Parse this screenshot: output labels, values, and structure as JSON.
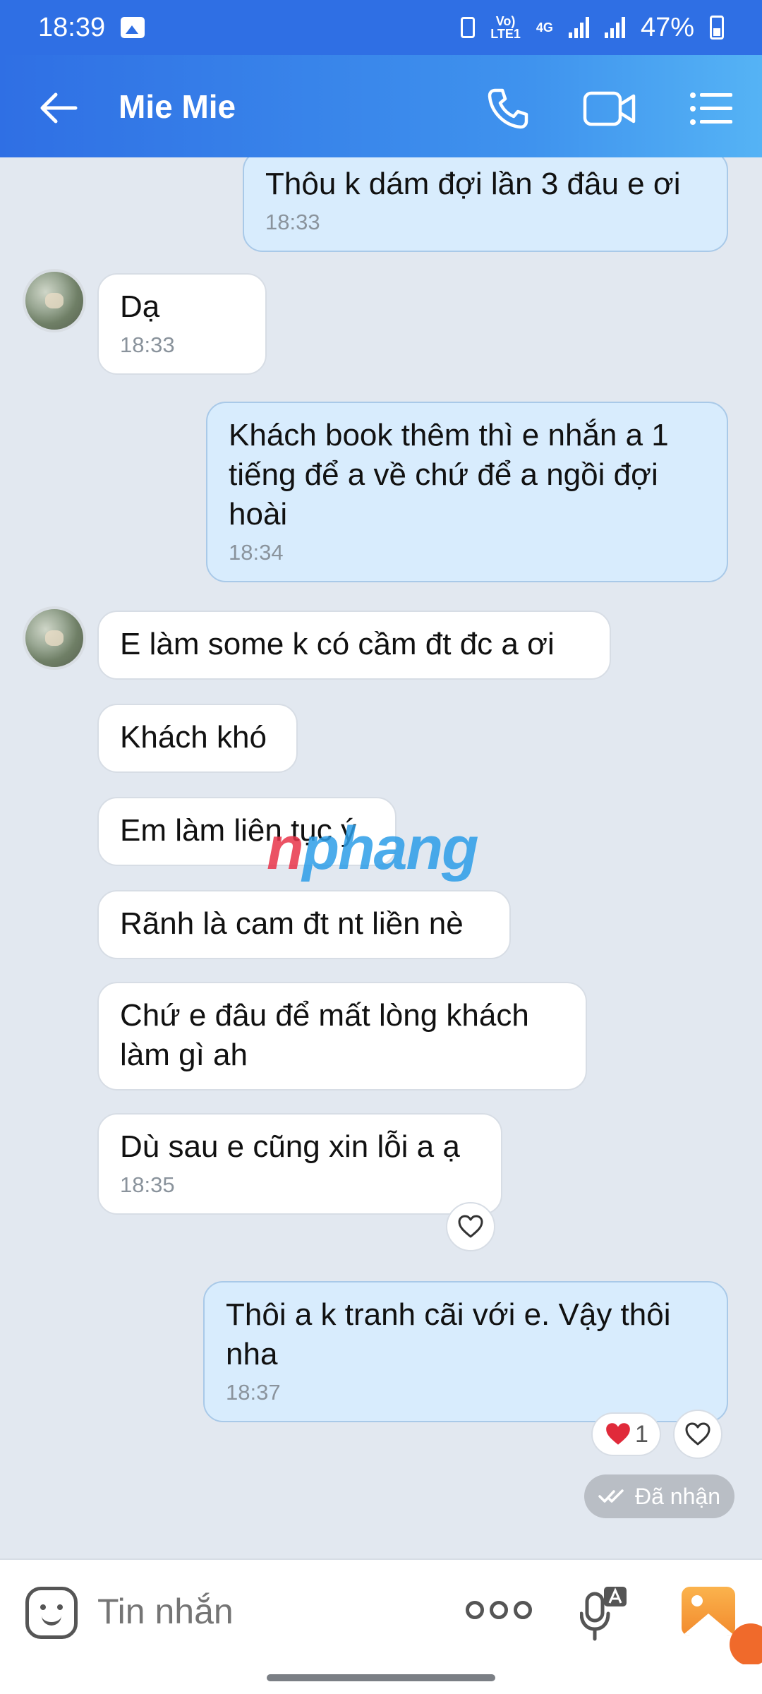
{
  "status_bar": {
    "time": "18:39",
    "network_top": "Vo)",
    "network_bottom": "LTE1",
    "network_gen": "4G",
    "battery": "47%"
  },
  "header": {
    "contact_name": "Mie Mie"
  },
  "messages": [
    {
      "direction": "out",
      "text": "Thôu k dám đợi lần 3 đâu e ơi",
      "time": "18:33"
    },
    {
      "direction": "in",
      "text": "Dạ",
      "time": "18:33"
    },
    {
      "direction": "out",
      "text": "Khách book thêm thì e nhắn a 1 tiếng để a về chứ để a ngồi đợi hoài",
      "time": "18:34"
    },
    {
      "direction": "in",
      "text": "E làm some k có cầm đt đc a ơi",
      "time": ""
    },
    {
      "direction": "in",
      "text": "Khách khó",
      "time": ""
    },
    {
      "direction": "in",
      "text": "Em làm liên tục ý",
      "time": ""
    },
    {
      "direction": "in",
      "text": "Rãnh là cam đt nt liền nè",
      "time": ""
    },
    {
      "direction": "in",
      "text": "Chứ e đâu để mất lòng khách làm gì ah",
      "time": ""
    },
    {
      "direction": "in",
      "text": "Dù sau e cũng xin lỗi a ạ",
      "time": "18:35"
    },
    {
      "direction": "out",
      "text": "Thôi a k tranh cãi với e. Vậy thôi nha",
      "time": "18:37"
    }
  ],
  "reaction": {
    "icon": "heart-icon",
    "count": "1"
  },
  "delivery_status": "Đã nhận",
  "watermark": {
    "first": "n",
    "rest": "phang"
  },
  "input": {
    "placeholder": "Tin nhắn"
  },
  "colors": {
    "header": "#2f6fe4",
    "outgoing_bubble": "#d8ecfd",
    "incoming_bubble": "#ffffff",
    "chat_bg": "#e2e8f0"
  }
}
